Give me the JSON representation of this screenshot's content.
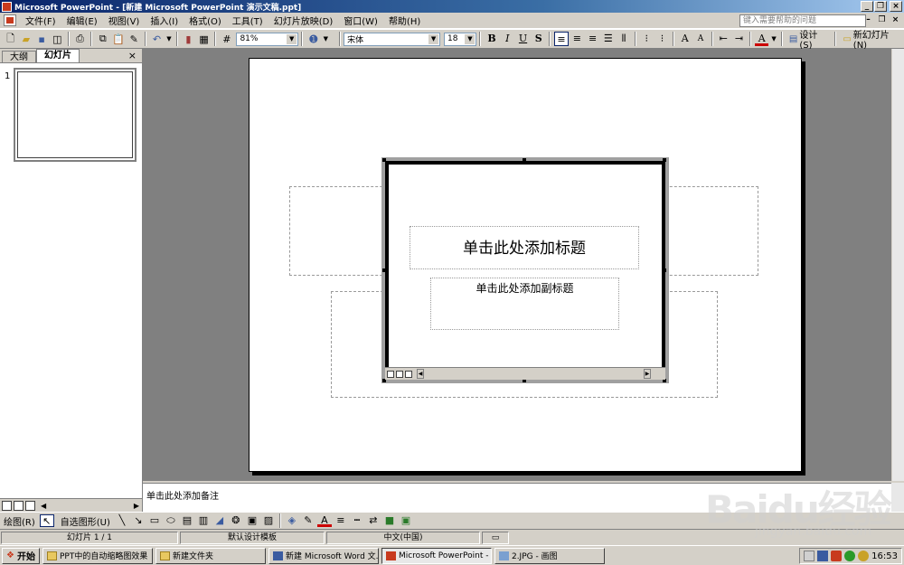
{
  "titlebar": {
    "title": "Microsoft PowerPoint - [新建 Microsoft PowerPoint 演示文稿.ppt]"
  },
  "menubar": {
    "items": [
      "文件(F)",
      "编辑(E)",
      "视图(V)",
      "插入(I)",
      "格式(O)",
      "工具(T)",
      "幻灯片放映(D)",
      "窗口(W)",
      "帮助(H)"
    ],
    "help_placeholder": "键入需要帮助的问题"
  },
  "toolbar": {
    "zoom": "81%",
    "font_name": "宋体",
    "font_size": "18",
    "design_label": "设计(S)",
    "new_slide_label": "新幻灯片(N)"
  },
  "leftpanel": {
    "tab_outline": "大纲",
    "tab_slides": "幻灯片",
    "slide_number": "1"
  },
  "slide": {
    "title_placeholder": "单击此处添加标题",
    "subtitle_placeholder": "单击此处添加副标题"
  },
  "notes": {
    "placeholder": "单击此处添加备注"
  },
  "drawbar": {
    "draw_label": "绘图(R)",
    "autoshape_label": "自选图形(U)"
  },
  "status": {
    "slide_info": "幻灯片 1 / 1",
    "template": "默认设计模板",
    "language": "中文(中国)"
  },
  "taskbar": {
    "start_label": "开始",
    "tasks": [
      "PPT中的自动缩略图效果",
      "新建文件夹",
      "新建 Microsoft Word 文...",
      "Microsoft PowerPoint - [...",
      "2.JPG - 画图"
    ],
    "clock": "16:53"
  },
  "watermark": {
    "brand": "Baidu经验",
    "url": "jingyan.baidu.com"
  },
  "colors": {
    "title_bar_start": "#0a246a",
    "title_bar_end": "#a6caf0",
    "chrome": "#d4d0c8",
    "workspace": "#808080"
  }
}
